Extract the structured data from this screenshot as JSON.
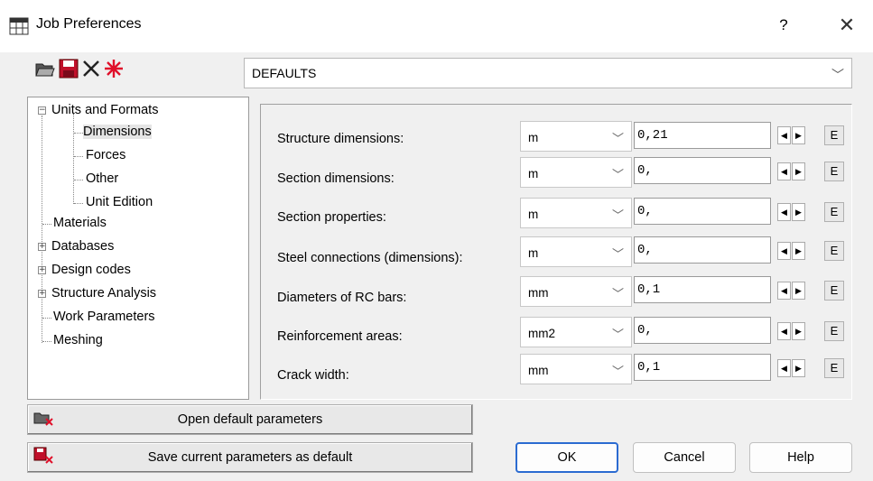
{
  "window": {
    "title": "Job Preferences",
    "help": "?",
    "close": "✕"
  },
  "toolbar": {
    "icons": [
      "open-folder-icon",
      "save-disk-icon",
      "delete-x-icon",
      "reset-star-icon"
    ]
  },
  "preset": {
    "value": "DEFAULTS"
  },
  "tree": {
    "items": [
      {
        "label": "Units and Formats",
        "expander": "−"
      },
      {
        "label": "Dimensions",
        "selected": true
      },
      {
        "label": "Forces"
      },
      {
        "label": "Other"
      },
      {
        "label": "Unit Edition"
      },
      {
        "label": "Materials"
      },
      {
        "label": "Databases",
        "expander": "+"
      },
      {
        "label": "Design codes",
        "expander": "+"
      },
      {
        "label": "Structure Analysis",
        "expander": "+"
      },
      {
        "label": "Work Parameters"
      },
      {
        "label": "Meshing"
      }
    ]
  },
  "rows": [
    {
      "label": "Structure dimensions:",
      "unit": "m",
      "precision": "0,21",
      "edit": "E"
    },
    {
      "label": "Section dimensions:",
      "unit": "m",
      "precision": "0,",
      "edit": "E"
    },
    {
      "label": "Section properties:",
      "unit": "m",
      "precision": "0,",
      "edit": "E"
    },
    {
      "label": "Steel connections (dimensions):",
      "unit": "m",
      "precision": "0,",
      "edit": "E"
    },
    {
      "label": "Diameters of RC bars:",
      "unit": "mm",
      "precision": "0,1",
      "edit": "E"
    },
    {
      "label": "Reinforcement areas:",
      "unit": "mm2",
      "precision": "0,",
      "edit": "E"
    },
    {
      "label": "Crack width:",
      "unit": "mm",
      "precision": "0,1",
      "edit": "E"
    }
  ],
  "buttons": {
    "open_default": "Open default parameters",
    "save_default": "Save current parameters as default",
    "ok": "OK",
    "cancel": "Cancel",
    "help": "Help"
  }
}
